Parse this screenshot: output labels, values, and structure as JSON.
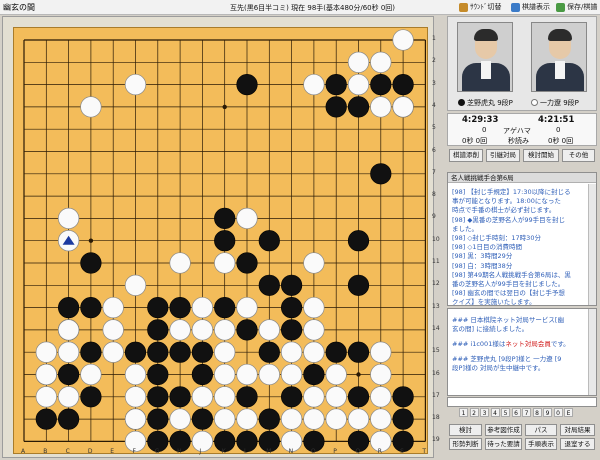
{
  "window": {
    "title": "幽玄の間"
  },
  "game_status": "互先(黒6目半コミ) 現在 98手(基本480分/60秒 0回)",
  "toolbar": {
    "settings": "ｻｳﾝﾄﾞ切替",
    "display": "棋譜表示",
    "save": "保存/棋譜"
  },
  "board": {
    "files": [
      "A",
      "B",
      "C",
      "D",
      "E",
      "F",
      "G",
      "H",
      "J",
      "K",
      "L",
      "M",
      "N",
      "O",
      "P",
      "Q",
      "R",
      "S",
      "T"
    ],
    "ranks": [
      "1",
      "2",
      "3",
      "4",
      "5",
      "6",
      "7",
      "8",
      "9",
      "10",
      "11",
      "12",
      "13",
      "14",
      "15",
      "16",
      "17",
      "18",
      "19"
    ],
    "black_stones": [
      [
        10,
        2
      ],
      [
        14,
        2
      ],
      [
        16,
        2
      ],
      [
        17,
        2
      ],
      [
        14,
        3
      ],
      [
        15,
        3
      ],
      [
        17,
        3
      ],
      [
        16,
        6
      ],
      [
        9,
        8
      ],
      [
        9,
        9
      ],
      [
        11,
        9
      ],
      [
        15,
        9
      ],
      [
        3,
        10
      ],
      [
        10,
        10
      ],
      [
        11,
        11
      ],
      [
        12,
        11
      ],
      [
        15,
        11
      ],
      [
        2,
        12
      ],
      [
        3,
        12
      ],
      [
        6,
        12
      ],
      [
        7,
        12
      ],
      [
        9,
        12
      ],
      [
        12,
        12
      ],
      [
        2,
        13
      ],
      [
        6,
        13
      ],
      [
        10,
        13
      ],
      [
        12,
        13
      ],
      [
        3,
        14
      ],
      [
        5,
        14
      ],
      [
        6,
        14
      ],
      [
        7,
        14
      ],
      [
        8,
        14
      ],
      [
        11,
        14
      ],
      [
        14,
        14
      ],
      [
        15,
        14
      ],
      [
        1,
        15
      ],
      [
        2,
        15
      ],
      [
        6,
        15
      ],
      [
        8,
        15
      ],
      [
        13,
        15
      ],
      [
        3,
        16
      ],
      [
        6,
        16
      ],
      [
        7,
        16
      ],
      [
        10,
        16
      ],
      [
        12,
        16
      ],
      [
        15,
        16
      ],
      [
        17,
        16
      ],
      [
        1,
        17
      ],
      [
        2,
        17
      ],
      [
        5,
        17
      ],
      [
        6,
        17
      ],
      [
        8,
        17
      ],
      [
        11,
        17
      ],
      [
        17,
        17
      ],
      [
        6,
        18
      ],
      [
        7,
        18
      ],
      [
        9,
        18
      ],
      [
        10,
        18
      ],
      [
        11,
        18
      ],
      [
        13,
        18
      ],
      [
        15,
        18
      ],
      [
        17,
        18
      ]
    ],
    "white_stones": [
      [
        17,
        0
      ],
      [
        15,
        1
      ],
      [
        16,
        1
      ],
      [
        5,
        2
      ],
      [
        13,
        2
      ],
      [
        15,
        2
      ],
      [
        3,
        3
      ],
      [
        16,
        3
      ],
      [
        17,
        3
      ],
      [
        2,
        8
      ],
      [
        10,
        8
      ],
      [
        2,
        9
      ],
      [
        7,
        10
      ],
      [
        9,
        10
      ],
      [
        13,
        10
      ],
      [
        5,
        11
      ],
      [
        4,
        12
      ],
      [
        8,
        12
      ],
      [
        10,
        12
      ],
      [
        13,
        12
      ],
      [
        2,
        13
      ],
      [
        4,
        13
      ],
      [
        7,
        13
      ],
      [
        8,
        13
      ],
      [
        9,
        13
      ],
      [
        11,
        13
      ],
      [
        13,
        13
      ],
      [
        1,
        14
      ],
      [
        2,
        14
      ],
      [
        4,
        14
      ],
      [
        9,
        14
      ],
      [
        12,
        14
      ],
      [
        13,
        14
      ],
      [
        16,
        14
      ],
      [
        1,
        15
      ],
      [
        3,
        15
      ],
      [
        5,
        15
      ],
      [
        9,
        15
      ],
      [
        10,
        15
      ],
      [
        11,
        15
      ],
      [
        12,
        15
      ],
      [
        14,
        15
      ],
      [
        16,
        15
      ],
      [
        1,
        16
      ],
      [
        2,
        16
      ],
      [
        5,
        16
      ],
      [
        8,
        16
      ],
      [
        9,
        16
      ],
      [
        13,
        16
      ],
      [
        14,
        16
      ],
      [
        16,
        16
      ],
      [
        5,
        17
      ],
      [
        7,
        17
      ],
      [
        9,
        17
      ],
      [
        10,
        17
      ],
      [
        12,
        17
      ],
      [
        13,
        17
      ],
      [
        14,
        17
      ],
      [
        15,
        17
      ],
      [
        16,
        17
      ],
      [
        5,
        18
      ],
      [
        8,
        18
      ],
      [
        12,
        18
      ],
      [
        16,
        18
      ]
    ],
    "last_move": [
      2,
      9
    ]
  },
  "players": {
    "white": {
      "name": "芝野虎丸 9段P",
      "time": "4:29:33",
      "byoyomi": "0秒 0回"
    },
    "black": {
      "name": "一力遼 9段P",
      "time": "4:21:51",
      "byoyomi": "0秒 0回"
    },
    "agehama_label": "アゲハマ",
    "white_agehama": "0",
    "black_agehama": "0",
    "byoyomi_label": "秒読み"
  },
  "actions": {
    "register": "棋譜添削",
    "request": "引継対局",
    "study": "検討開始",
    "other": "その他"
  },
  "commentary": {
    "title": "名人戦挑戦手合第6局",
    "lines": [
      "[98] 【封じ手規定】17:30以降に封じる",
      "事が可能となります。18:00になった",
      "時点で手番の棋士が必ず封じます。",
      "[98] ◆黒番の芝野名人が99手目を封じ",
      "ました。",
      "[98] ◇封じ手時刻：17時30分",
      "[98] ◇1日目の消費時間",
      "[98] 黒：3時間29分",
      "[98] 白：3時間38分",
      "[98] 第49期名人戦挑戦手合第6局は、黒",
      "番の芝野名人が99手目を封じました。",
      "[98] 幽玄の間では翌日の【封じ手予想",
      "クイズ】を実施いたします。"
    ]
  },
  "chat": {
    "l1": "### 日本棋院ネット対局サービス[幽",
    "l2": "玄の間] に接続しました。",
    "l3a": "### ",
    "l3b": "ネット対局会員",
    "l3c": "です。",
    "l3pre": "i1c001様は",
    "l4": "### 芝野虎丸 [9段P]様と 一力遼 [9",
    "l5": "段P]様の 対局が生中継中です。"
  },
  "emoji": [
    "1",
    "2",
    "3",
    "4",
    "5",
    "6",
    "7",
    "8",
    "9",
    "0",
    "E"
  ],
  "bottom": {
    "b1": "検討",
    "b2": "参考図作成",
    "b3": "パス",
    "b4": "対局結果",
    "b5": "形勢判断",
    "b6": "待った要請",
    "b7": "手順表示",
    "b8": "退室する"
  }
}
